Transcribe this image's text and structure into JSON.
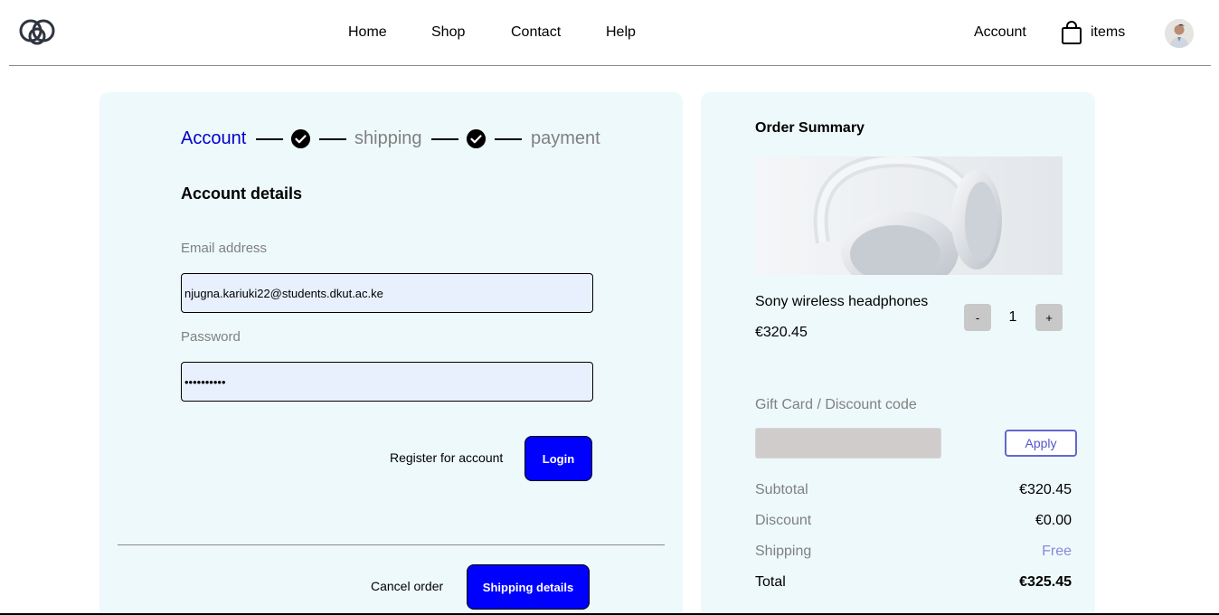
{
  "header": {
    "nav": {
      "home": "Home",
      "shop": "Shop",
      "contact": "Contact",
      "help": "Help"
    },
    "account_label": "Account",
    "cart_label": "items",
    "icons": [
      "logo-icon",
      "shopping-bag-icon",
      "avatar"
    ]
  },
  "steps": {
    "account": "Account",
    "shipping": "shipping",
    "payment": "payment",
    "active_color": "#0000cc",
    "muted_color": "#808080"
  },
  "account_form": {
    "title": "Account details",
    "email_label": "Email address",
    "email_value": "njugna.kariuki22@students.dkut.ac.ke",
    "password_label": "Password",
    "password_value": "••••••••••",
    "register_label": "Register for account",
    "login_label": "Login",
    "cancel_label": "Cancel order",
    "shipping_details_label": "Shipping details"
  },
  "summary": {
    "title": "Order Summary",
    "product_name": "Sony wireless headphones",
    "product_price": "€320.45",
    "qty_minus": "-",
    "qty_value": "1",
    "qty_plus": "+",
    "gift_label": "Gift Card / Discount code",
    "gift_value": "",
    "apply_label": "Apply",
    "subtotal_label": "Subtotal",
    "subtotal_value": "€320.45",
    "discount_label": "Discount",
    "discount_value": "€0.00",
    "shipping_label": "Shipping",
    "shipping_value": "Free",
    "total_label": "Total",
    "total_value": "€325.45"
  },
  "colors": {
    "accent_blue": "#0000ff",
    "panel_bg": "#eef9fb",
    "free_color": "#8888dd"
  }
}
